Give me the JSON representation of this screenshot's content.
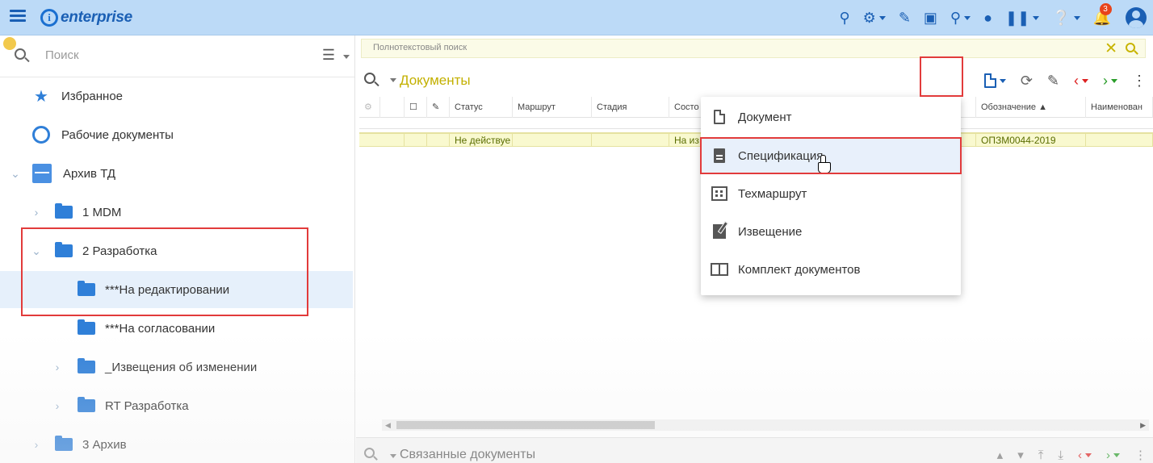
{
  "app": {
    "logo_text": "enterprise",
    "notification_count": "3"
  },
  "sidebar": {
    "search_placeholder": "Поиск",
    "items": [
      {
        "label": "Избранное"
      },
      {
        "label": "Рабочие документы"
      },
      {
        "label": "Архив ТД"
      },
      {
        "label": "1 MDM"
      },
      {
        "label": "2 Разработка"
      },
      {
        "label": "***На редактировании"
      },
      {
        "label": "***На согласовании"
      },
      {
        "label": "_Извещения об изменении"
      },
      {
        "label": "RT Разработка"
      },
      {
        "label": "3 Архив"
      }
    ]
  },
  "main": {
    "fulltext_placeholder": "Полнотекстовый поиск",
    "panel_title": "Документы",
    "columns": [
      "Статус",
      "Маршрут",
      "Стадия",
      "Состо",
      "Обозначение",
      "Наименован"
    ],
    "row": {
      "status": "Не действуе",
      "state": "На из",
      "designation": "ОПЗМ0044-2019"
    },
    "bottom_panel_title": "Связанные документы"
  },
  "create_menu": {
    "items": [
      {
        "label": "Документ",
        "icon": "document-icon"
      },
      {
        "label": "Спецификация",
        "icon": "specification-icon"
      },
      {
        "label": "Техмаршрут",
        "icon": "route-icon"
      },
      {
        "label": "Извещение",
        "icon": "notice-icon"
      },
      {
        "label": "Комплект документов",
        "icon": "document-set-icon"
      }
    ],
    "highlighted": "Спецификация"
  },
  "colors": {
    "topbar": "#bcdaf7",
    "brand": "#1a5fb4",
    "title_accent": "#c3b000",
    "highlight_box": "#e23b3b"
  }
}
